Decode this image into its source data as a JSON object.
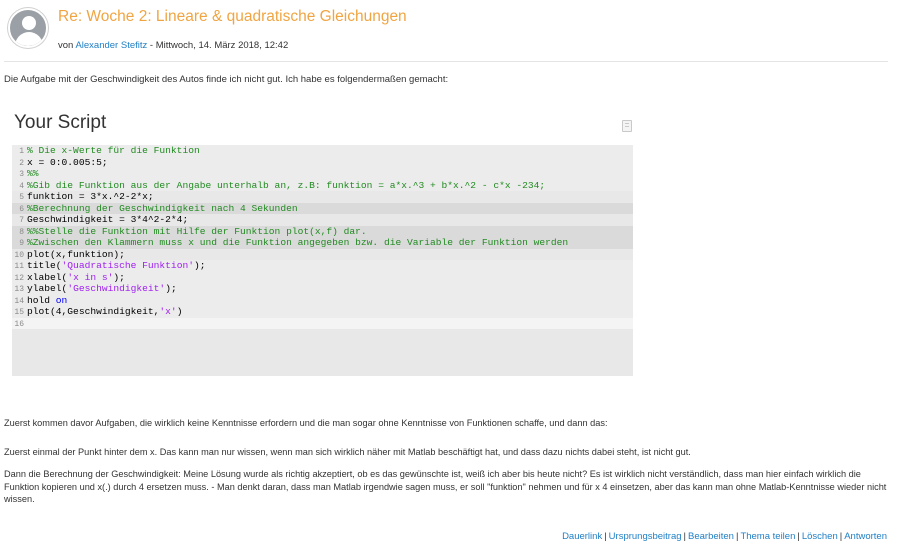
{
  "post": {
    "title": "Re: Woche 2: Lineare & quadratische Gleichungen",
    "by_prefix": "von ",
    "author": "Alexander Stefitz",
    "date_suffix": " - Mittwoch, 14. März 2018, 12:42",
    "intro": "Die Aufgabe mit der Geschwindigkeit des Autos finde ich nicht gut. Ich habe es folgendermaßen gemacht:"
  },
  "script": {
    "title": "Your Script",
    "lines": [
      {
        "n": "1",
        "parts": [
          {
            "cls": "t-comment",
            "text": "% Die x-Werte für die Funktion"
          }
        ]
      },
      {
        "n": "2",
        "parts": [
          {
            "cls": "t-plain",
            "text": "x = 0:0.005:5;"
          }
        ]
      },
      {
        "n": "3",
        "parts": [
          {
            "cls": "t-comment",
            "text": "%%"
          }
        ]
      },
      {
        "n": "4",
        "parts": [
          {
            "cls": "t-comment",
            "text": "%Gib die Funktion aus der Angabe unterhalb an, z.B: funktion = a*x.^3 + b*x.^2 - c*x -234;"
          }
        ]
      },
      {
        "n": "5",
        "parts": [
          {
            "cls": "t-plain",
            "text": "funktion = 3*x.^2-2*x;"
          }
        ]
      },
      {
        "n": "6",
        "parts": [
          {
            "cls": "t-comment",
            "text": "%Berechnung der Geschwindigkeit nach 4 Sekunden"
          }
        ]
      },
      {
        "n": "7",
        "parts": [
          {
            "cls": "t-plain",
            "text": "Geschwindigkeit = 3*4^2-2*4;"
          }
        ]
      },
      {
        "n": "8",
        "parts": [
          {
            "cls": "t-comment",
            "text": "%%Stelle die Funktion mit Hilfe der Funktion plot(x,f) dar."
          }
        ]
      },
      {
        "n": "9",
        "parts": [
          {
            "cls": "t-comment",
            "text": "%Zwischen den Klammern muss x und die Funktion angegeben bzw. die Variable der Funktion werden"
          }
        ]
      },
      {
        "n": "10",
        "parts": [
          {
            "cls": "t-plain",
            "text": "plot(x,funktion);"
          }
        ]
      },
      {
        "n": "11",
        "parts": [
          {
            "cls": "t-plain",
            "text": "title("
          },
          {
            "cls": "t-string",
            "text": "'Quadratische Funktion'"
          },
          {
            "cls": "t-plain",
            "text": ");"
          }
        ]
      },
      {
        "n": "12",
        "parts": [
          {
            "cls": "t-plain",
            "text": "xlabel("
          },
          {
            "cls": "t-string",
            "text": "'x in s'"
          },
          {
            "cls": "t-plain",
            "text": ");"
          }
        ]
      },
      {
        "n": "13",
        "parts": [
          {
            "cls": "t-plain",
            "text": "ylabel("
          },
          {
            "cls": "t-string",
            "text": "'Geschwindigkeit'"
          },
          {
            "cls": "t-plain",
            "text": ");"
          }
        ]
      },
      {
        "n": "14",
        "parts": [
          {
            "cls": "t-plain",
            "text": "hold "
          },
          {
            "cls": "t-keyword",
            "text": "on"
          }
        ]
      },
      {
        "n": "15",
        "parts": [
          {
            "cls": "t-plain",
            "text": "plot(4,Geschwindigkeit,"
          },
          {
            "cls": "t-string",
            "text": "'x'"
          },
          {
            "cls": "t-plain",
            "text": ")"
          }
        ]
      },
      {
        "n": "16",
        "parts": []
      }
    ]
  },
  "body": {
    "p1": "Zuerst kommen davor Aufgaben, die wirklich keine Kenntnisse erfordern und die man sogar ohne Kenntnisse von Funktionen schaffe, und dann das:",
    "p2": "Zuerst einmal der Punkt hinter dem x. Das kann man nur wissen, wenn man sich wirklich näher mit Matlab beschäftigt hat, und dass dazu nichts dabei steht, ist nicht gut.",
    "p3": "Dann die Berechnung der Geschwindigkeit: Meine Lösung wurde als richtig akzeptiert, ob es das gewünschte ist, weiß ich aber bis heute nicht? Es ist wirklich nicht verständlich, dass man hier einfach wirklich die Funktion kopieren und x(.) durch 4 ersetzen muss. - Man denkt daran, dass man Matlab irgendwie sagen muss, er soll \"funktion\" nehmen und für x 4 einsetzen, aber  das kann man ohne Matlab-Kenntnisse wieder nicht wissen."
  },
  "footer": {
    "links": [
      "Dauerlink",
      "Ursprungsbeitrag",
      "Bearbeiten",
      "Thema teilen",
      "Löschen",
      "Antworten"
    ],
    "separator": "|"
  },
  "icons": {
    "avatar": "user-avatar-icon",
    "copy": "copy-icon"
  },
  "colors": {
    "title": "#f0a542",
    "link": "#1f7fc5",
    "comment": "#228b22",
    "string": "#a020f0",
    "keyword": "#0000ff"
  }
}
